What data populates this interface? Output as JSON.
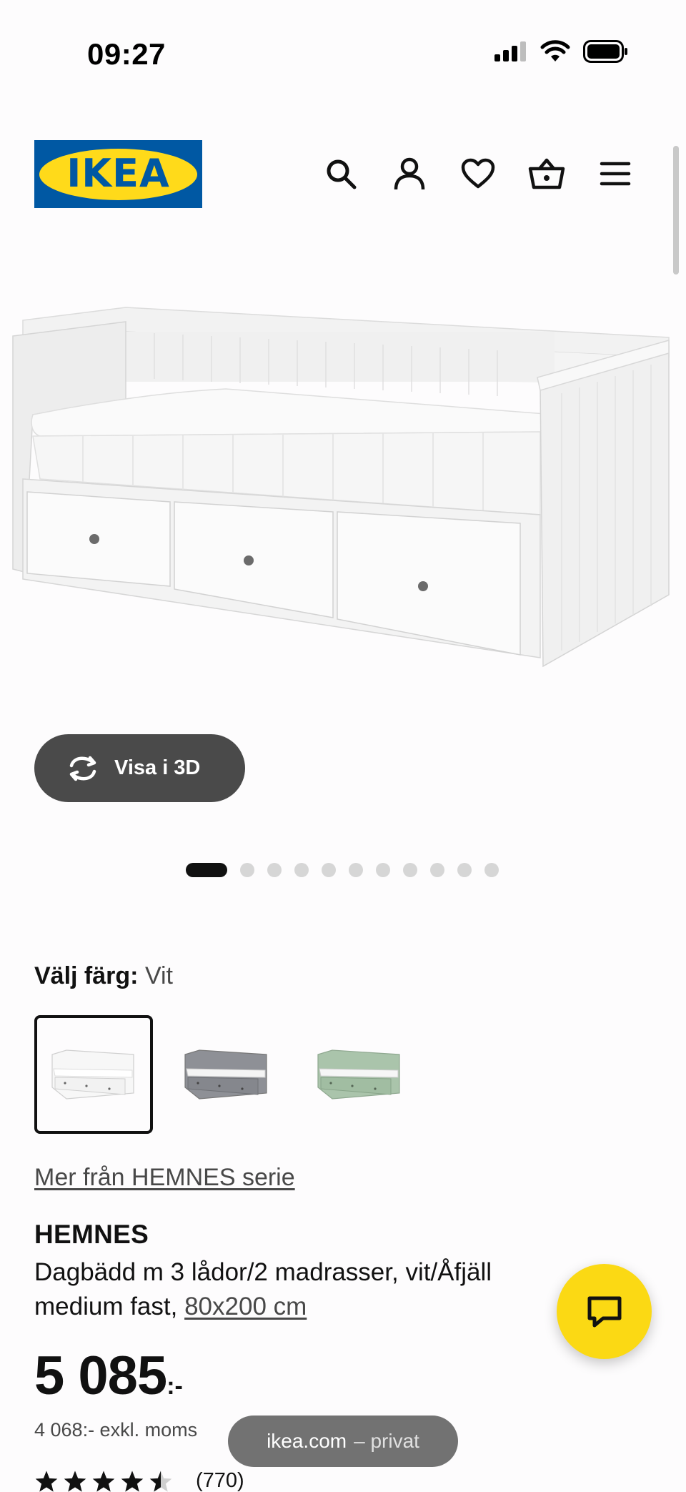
{
  "status_bar": {
    "time": "09:27"
  },
  "header": {
    "logo_text": "IKEA",
    "icons": [
      "search-icon",
      "account-icon",
      "heart-icon",
      "cart-icon",
      "menu-icon"
    ]
  },
  "product_gallery": {
    "button_3d": "Visa i 3D",
    "page_count": 11,
    "active_page": 1
  },
  "color_selector": {
    "label": "Välj färg:",
    "selected": "Vit",
    "options": [
      {
        "color": "#ffffff",
        "selected": true
      },
      {
        "color": "#8a8c92",
        "selected": false
      },
      {
        "color": "#a9c3a9",
        "selected": false
      }
    ]
  },
  "series_link": "Mer från HEMNES serie",
  "product": {
    "brand": "HEMNES",
    "description": "Dagbädd m 3 lådor/2 madrasser, vit/Åfjäll medium fast, ",
    "size": "80x200 cm",
    "price": "5 085",
    "price_suffix": ":-",
    "price_excl_vat": "4 068:- exkl. moms",
    "rating": 4.5,
    "rating_count": "(770)"
  },
  "browser": {
    "domain": "ikea.com",
    "mode": "– privat"
  },
  "colors": {
    "ikea_blue": "#0058a3",
    "ikea_yellow": "#ffda1a",
    "chat_yellow": "#fbd914"
  }
}
